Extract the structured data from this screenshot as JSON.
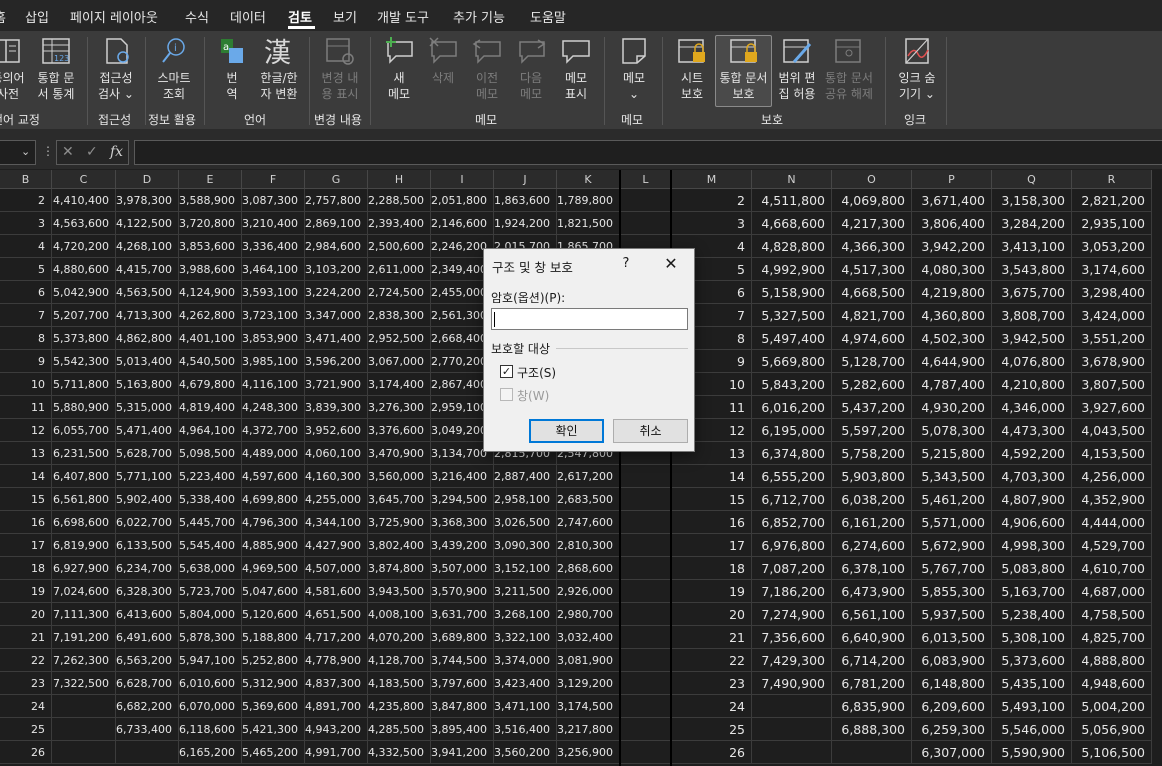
{
  "menu": {
    "tabs": [
      "홈",
      "삽입",
      "페이지 레이아웃",
      "수식",
      "데이터",
      "검토",
      "보기",
      "개발 도구",
      "추가 기능",
      "도움말"
    ],
    "active_tab": "검토"
  },
  "ribbon": {
    "buttons": {
      "thesaurus": {
        "line1": "동의어",
        "line2": "사전"
      },
      "workbook_stats": {
        "line1": "통합 문",
        "line2": "서 통계"
      },
      "accessibility": {
        "line1": "접근성",
        "line2": "검사 ⌄"
      },
      "smart_lookup": {
        "line1": "스마트",
        "line2": "조회"
      },
      "translate": {
        "line1": "번",
        "line2": "역"
      },
      "hanja": {
        "line1": "한글/한",
        "line2": "자 변환"
      },
      "show_changes": {
        "line1": "변경 내",
        "line2": "용 표시"
      },
      "new_comment": {
        "line1": "새",
        "line2": "메모"
      },
      "delete": {
        "line1": "삭제",
        "line2": ""
      },
      "prev": {
        "line1": "이전",
        "line2": "메모"
      },
      "next": {
        "line1": "다음",
        "line2": "메모"
      },
      "show_comments": {
        "line1": "메모",
        "line2": "표시"
      },
      "notes": {
        "line1": "메모",
        "line2": "⌄"
      },
      "protect_sheet": {
        "line1": "시트",
        "line2": "보호"
      },
      "protect_workbook": {
        "line1": "통합 문서",
        "line2": "보호"
      },
      "allow_edit": {
        "line1": "범위 편",
        "line2": "집 허용"
      },
      "unshare": {
        "line1": "통합 문서",
        "line2": "공유 해제"
      },
      "hide_ink": {
        "line1": "잉크 숨",
        "line2": "기기 ⌄"
      }
    },
    "groups": [
      "언어 교정",
      "접근성",
      "정보 활용",
      "언어",
      "변경 내용",
      "메모",
      "메모",
      "보호",
      "잉크"
    ]
  },
  "formula_bar": {
    "fx_label": "fx",
    "value": ""
  },
  "columns_left": [
    "B",
    "C",
    "D",
    "E",
    "F",
    "G",
    "H",
    "I",
    "J",
    "K",
    "L"
  ],
  "columns_right": [
    "M",
    "N",
    "O",
    "P",
    "Q",
    "R"
  ],
  "rows_left": [
    [
      "2",
      "4,410,400",
      "3,978,300",
      "3,588,900",
      "3,087,300",
      "2,757,800",
      "2,288,500",
      "2,051,800",
      "1,863,600",
      "1,789,800"
    ],
    [
      "3",
      "4,563,600",
      "4,122,500",
      "3,720,800",
      "3,210,400",
      "2,869,100",
      "2,393,400",
      "2,146,600",
      "1,924,200",
      "1,821,500"
    ],
    [
      "4",
      "4,720,200",
      "4,268,100",
      "3,853,600",
      "3,336,400",
      "2,984,600",
      "2,500,600",
      "2,246,200",
      "2,015,700",
      "1,865,700"
    ],
    [
      "5",
      "4,880,600",
      "4,415,700",
      "3,988,600",
      "3,464,100",
      "3,103,200",
      "2,611,000",
      "2,349,400",
      "",
      ""
    ],
    [
      "6",
      "5,042,900",
      "4,563,500",
      "4,124,900",
      "3,593,100",
      "3,224,200",
      "2,724,500",
      "2,455,000",
      "",
      ""
    ],
    [
      "7",
      "5,207,700",
      "4,713,300",
      "4,262,800",
      "3,723,100",
      "3,347,000",
      "2,838,300",
      "2,561,300",
      "",
      ""
    ],
    [
      "8",
      "5,373,800",
      "4,862,800",
      "4,401,100",
      "3,853,900",
      "3,471,400",
      "2,952,500",
      "2,668,400",
      "",
      ""
    ],
    [
      "9",
      "5,542,300",
      "5,013,400",
      "4,540,500",
      "3,985,100",
      "3,596,200",
      "3,067,000",
      "2,770,200",
      "",
      ""
    ],
    [
      "10",
      "5,711,800",
      "5,163,800",
      "4,679,800",
      "4,116,100",
      "3,721,900",
      "3,174,400",
      "2,867,400",
      "",
      ""
    ],
    [
      "11",
      "5,880,900",
      "5,315,000",
      "4,819,400",
      "4,248,300",
      "3,839,300",
      "3,276,300",
      "2,959,100",
      "",
      ""
    ],
    [
      "12",
      "6,055,700",
      "5,471,400",
      "4,964,100",
      "4,372,700",
      "3,952,600",
      "3,376,600",
      "3,049,200",
      "",
      ""
    ],
    [
      "13",
      "6,231,500",
      "5,628,700",
      "5,098,500",
      "4,489,000",
      "4,060,100",
      "3,470,900",
      "3,134,700",
      "2,815,700",
      "2,547,800"
    ],
    [
      "14",
      "6,407,800",
      "5,771,100",
      "5,223,400",
      "4,597,600",
      "4,160,300",
      "3,560,000",
      "3,216,400",
      "2,887,400",
      "2,617,200"
    ],
    [
      "15",
      "6,561,800",
      "5,902,400",
      "5,338,400",
      "4,699,800",
      "4,255,000",
      "3,645,700",
      "3,294,500",
      "2,958,100",
      "2,683,500"
    ],
    [
      "16",
      "6,698,600",
      "6,022,700",
      "5,445,700",
      "4,796,300",
      "4,344,100",
      "3,725,900",
      "3,368,300",
      "3,026,500",
      "2,747,600"
    ],
    [
      "17",
      "6,819,900",
      "6,133,500",
      "5,545,400",
      "4,885,900",
      "4,427,900",
      "3,802,400",
      "3,439,200",
      "3,090,300",
      "2,810,300"
    ],
    [
      "18",
      "6,927,900",
      "6,234,700",
      "5,638,000",
      "4,969,500",
      "4,507,000",
      "3,874,800",
      "3,507,000",
      "3,152,100",
      "2,868,600"
    ],
    [
      "19",
      "7,024,600",
      "6,328,300",
      "5,723,700",
      "5,047,600",
      "4,581,600",
      "3,943,500",
      "3,570,900",
      "3,211,500",
      "2,926,000"
    ],
    [
      "20",
      "7,111,300",
      "6,413,600",
      "5,804,000",
      "5,120,600",
      "4,651,500",
      "4,008,100",
      "3,631,700",
      "3,268,100",
      "2,980,700"
    ],
    [
      "21",
      "7,191,200",
      "6,491,600",
      "5,878,300",
      "5,188,800",
      "4,717,200",
      "4,070,200",
      "3,689,800",
      "3,322,100",
      "3,032,400"
    ],
    [
      "22",
      "7,262,300",
      "6,563,200",
      "5,947,100",
      "5,252,800",
      "4,778,900",
      "4,128,700",
      "3,744,500",
      "3,374,000",
      "3,081,900"
    ],
    [
      "23",
      "7,322,500",
      "6,628,700",
      "6,010,600",
      "5,312,900",
      "4,837,300",
      "4,183,500",
      "3,797,600",
      "3,423,400",
      "3,129,200"
    ],
    [
      "24",
      "",
      "6,682,200",
      "6,070,000",
      "5,369,600",
      "4,891,700",
      "4,235,800",
      "3,847,800",
      "3,471,100",
      "3,174,500"
    ],
    [
      "25",
      "",
      "6,733,400",
      "6,118,600",
      "5,421,300",
      "4,943,200",
      "4,285,500",
      "3,895,400",
      "3,516,400",
      "3,217,800"
    ],
    [
      "26",
      "",
      "",
      "6,165,200",
      "5,465,200",
      "4,991,700",
      "4,332,500",
      "3,941,200",
      "3,560,200",
      "3,256,900"
    ]
  ],
  "rows_right": [
    [
      "2",
      "4,511,800",
      "4,069,800",
      "3,671,400",
      "3,158,300",
      "2,821,200"
    ],
    [
      "3",
      "4,668,600",
      "4,217,300",
      "3,806,400",
      "3,284,200",
      "2,935,100"
    ],
    [
      "4",
      "4,828,800",
      "4,366,300",
      "3,942,200",
      "3,413,100",
      "3,053,200"
    ],
    [
      "5",
      "4,992,900",
      "4,517,300",
      "4,080,300",
      "3,543,800",
      "3,174,600"
    ],
    [
      "6",
      "5,158,900",
      "4,668,500",
      "4,219,800",
      "3,675,700",
      "3,298,400"
    ],
    [
      "7",
      "5,327,500",
      "4,821,700",
      "4,360,800",
      "3,808,700",
      "3,424,000"
    ],
    [
      "8",
      "5,497,400",
      "4,974,600",
      "4,502,300",
      "3,942,500",
      "3,551,200"
    ],
    [
      "9",
      "5,669,800",
      "5,128,700",
      "4,644,900",
      "4,076,800",
      "3,678,900"
    ],
    [
      "10",
      "5,843,200",
      "5,282,600",
      "4,787,400",
      "4,210,800",
      "3,807,500"
    ],
    [
      "11",
      "6,016,200",
      "5,437,200",
      "4,930,200",
      "4,346,000",
      "3,927,600"
    ],
    [
      "12",
      "6,195,000",
      "5,597,200",
      "5,078,300",
      "4,473,300",
      "4,043,500"
    ],
    [
      "13",
      "6,374,800",
      "5,758,200",
      "5,215,800",
      "4,592,200",
      "4,153,500"
    ],
    [
      "14",
      "6,555,200",
      "5,903,800",
      "5,343,500",
      "4,703,300",
      "4,256,000"
    ],
    [
      "15",
      "6,712,700",
      "6,038,200",
      "5,461,200",
      "4,807,900",
      "4,352,900"
    ],
    [
      "16",
      "6,852,700",
      "6,161,200",
      "5,571,000",
      "4,906,600",
      "4,444,000"
    ],
    [
      "17",
      "6,976,800",
      "6,274,600",
      "5,672,900",
      "4,998,300",
      "4,529,700"
    ],
    [
      "18",
      "7,087,200",
      "6,378,100",
      "5,767,700",
      "5,083,800",
      "4,610,700"
    ],
    [
      "19",
      "7,186,200",
      "6,473,900",
      "5,855,300",
      "5,163,700",
      "4,687,000"
    ],
    [
      "20",
      "7,274,900",
      "6,561,100",
      "5,937,500",
      "5,238,400",
      "4,758,500"
    ],
    [
      "21",
      "7,356,600",
      "6,640,900",
      "6,013,500",
      "5,308,100",
      "4,825,700"
    ],
    [
      "22",
      "7,429,300",
      "6,714,200",
      "6,083,900",
      "5,373,600",
      "4,888,800"
    ],
    [
      "23",
      "7,490,900",
      "6,781,200",
      "6,148,800",
      "5,435,100",
      "4,948,600"
    ],
    [
      "24",
      "",
      "6,835,900",
      "6,209,600",
      "5,493,100",
      "5,004,200"
    ],
    [
      "25",
      "",
      "6,888,300",
      "6,259,300",
      "5,546,000",
      "5,056,900"
    ],
    [
      "26",
      "",
      "",
      "6,307,000",
      "5,590,900",
      "5,106,500"
    ]
  ],
  "dialog": {
    "title": "구조 및 창 보호",
    "help": "?",
    "close": "✕",
    "password_label": "암호(옵션)(P):",
    "password_value": "",
    "group_label": "보호할 대상",
    "structure_label": "구조(S)",
    "structure_checked": true,
    "window_label": "창(W)",
    "window_checked": false,
    "ok_label": "확인",
    "cancel_label": "취소"
  }
}
